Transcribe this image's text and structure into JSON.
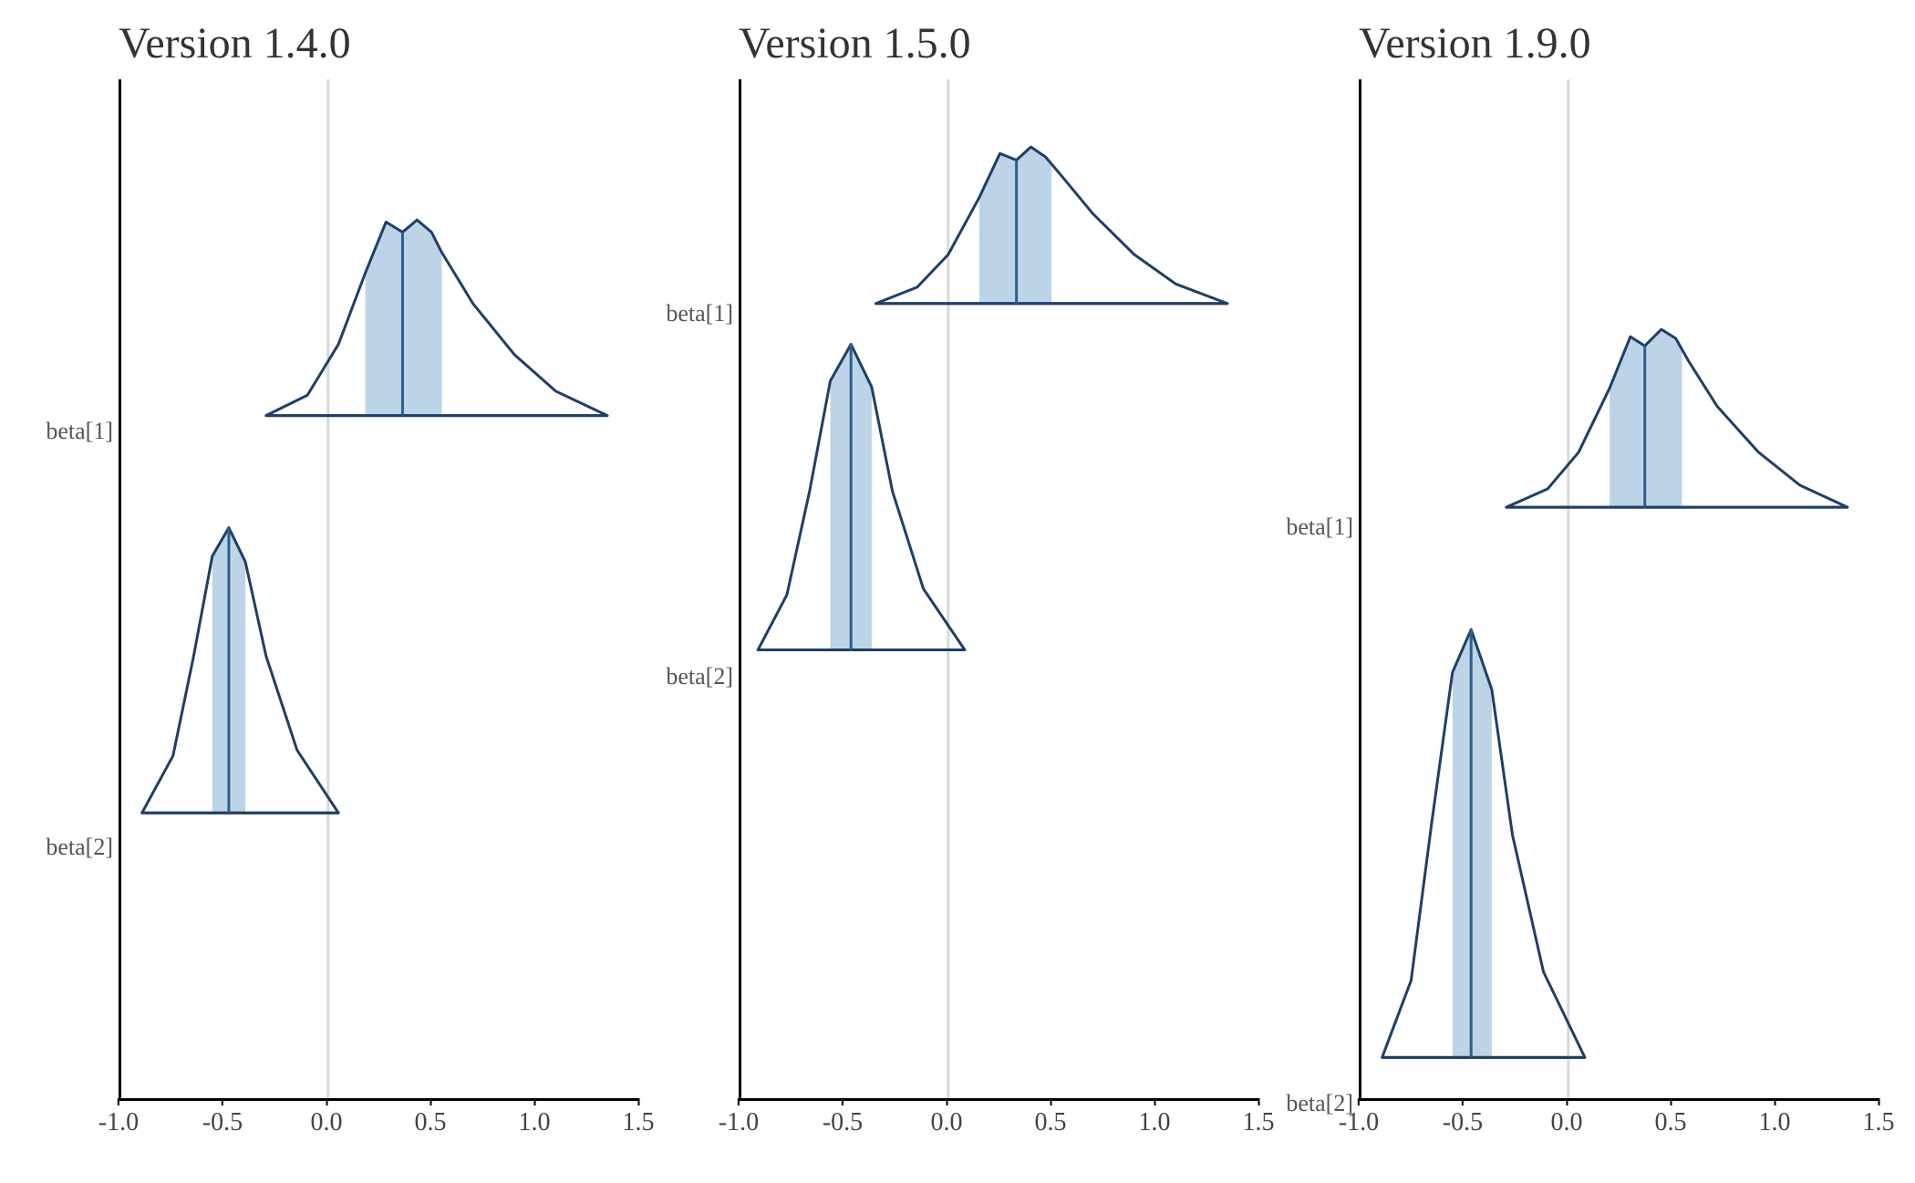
{
  "chart_data": [
    {
      "type": "area",
      "panel_title": "Version 1.4.0",
      "xlabel": "",
      "ylabel": "",
      "xlim": [
        -1.0,
        1.5
      ],
      "x_ticks": [
        -1.0,
        -0.5,
        0.0,
        0.5,
        1.0,
        1.5
      ],
      "y_categories": [
        "beta[1]",
        "beta[2]"
      ],
      "ridge": {
        "baseline_y_fraction": {
          "beta[1]": 0.33,
          "beta[2]": 0.72
        },
        "peak_height_fraction": {
          "beta[1]": 0.2,
          "beta[2]": 0.28
        }
      },
      "series": [
        {
          "name": "beta[1]",
          "point_estimate": 0.36,
          "interval": [
            0.18,
            0.55
          ],
          "density": {
            "x": [
              -0.3,
              -0.1,
              0.05,
              0.18,
              0.28,
              0.36,
              0.43,
              0.5,
              0.55,
              0.7,
              0.9,
              1.1,
              1.35
            ],
            "height": [
              0.0,
              0.1,
              0.35,
              0.7,
              0.95,
              0.9,
              0.96,
              0.9,
              0.8,
              0.55,
              0.3,
              0.12,
              0.0
            ]
          }
        },
        {
          "name": "beta[2]",
          "point_estimate": -0.48,
          "interval": [
            -0.56,
            -0.4
          ],
          "density": {
            "x": [
              -0.9,
              -0.75,
              -0.65,
              -0.56,
              -0.48,
              -0.4,
              -0.3,
              -0.15,
              0.05
            ],
            "height": [
              0.0,
              0.2,
              0.55,
              0.9,
              1.0,
              0.88,
              0.55,
              0.22,
              0.0
            ]
          }
        }
      ]
    },
    {
      "type": "area",
      "panel_title": "Version 1.5.0",
      "xlabel": "",
      "ylabel": "",
      "xlim": [
        -1.0,
        1.5
      ],
      "x_ticks": [
        -1.0,
        -0.5,
        0.0,
        0.5,
        1.0,
        1.5
      ],
      "y_categories": [
        "beta[1]",
        "beta[2]"
      ],
      "ridge": {
        "baseline_y_fraction": {
          "beta[1]": 0.22,
          "beta[2]": 0.56
        },
        "peak_height_fraction": {
          "beta[1]": 0.16,
          "beta[2]": 0.3
        }
      },
      "series": [
        {
          "name": "beta[1]",
          "point_estimate": 0.33,
          "interval": [
            0.15,
            0.5
          ],
          "density": {
            "x": [
              -0.35,
              -0.15,
              0.0,
              0.15,
              0.25,
              0.33,
              0.4,
              0.47,
              0.55,
              0.7,
              0.9,
              1.1,
              1.35
            ],
            "height": [
              0.0,
              0.1,
              0.3,
              0.65,
              0.92,
              0.88,
              0.96,
              0.9,
              0.78,
              0.55,
              0.3,
              0.12,
              0.0
            ]
          }
        },
        {
          "name": "beta[2]",
          "point_estimate": -0.47,
          "interval": [
            -0.57,
            -0.37
          ],
          "density": {
            "x": [
              -0.92,
              -0.78,
              -0.67,
              -0.57,
              -0.47,
              -0.37,
              -0.27,
              -0.12,
              0.08
            ],
            "height": [
              0.0,
              0.18,
              0.52,
              0.88,
              1.0,
              0.86,
              0.52,
              0.2,
              0.0
            ]
          }
        }
      ]
    },
    {
      "type": "area",
      "panel_title": "Version 1.9.0",
      "xlabel": "",
      "ylabel": "",
      "xlim": [
        -1.0,
        1.5
      ],
      "x_ticks": [
        -1.0,
        -0.5,
        0.0,
        0.5,
        1.0,
        1.5
      ],
      "y_categories": [
        "beta[1]",
        "beta[2]"
      ],
      "ridge": {
        "baseline_y_fraction": {
          "beta[1]": 0.42,
          "beta[2]": 0.96
        },
        "peak_height_fraction": {
          "beta[1]": 0.18,
          "beta[2]": 0.42
        }
      },
      "series": [
        {
          "name": "beta[1]",
          "point_estimate": 0.37,
          "interval": [
            0.2,
            0.55
          ],
          "density": {
            "x": [
              -0.3,
              -0.1,
              0.05,
              0.2,
              0.3,
              0.37,
              0.45,
              0.52,
              0.58,
              0.72,
              0.92,
              1.12,
              1.35
            ],
            "height": [
              0.0,
              0.1,
              0.3,
              0.65,
              0.93,
              0.88,
              0.97,
              0.92,
              0.8,
              0.55,
              0.3,
              0.12,
              0.0
            ]
          }
        },
        {
          "name": "beta[2]",
          "point_estimate": -0.47,
          "interval": [
            -0.56,
            -0.37
          ],
          "density": {
            "x": [
              -0.9,
              -0.76,
              -0.66,
              -0.56,
              -0.47,
              -0.37,
              -0.27,
              -0.12,
              0.08
            ],
            "height": [
              0.0,
              0.18,
              0.55,
              0.9,
              1.0,
              0.86,
              0.52,
              0.2,
              0.0
            ]
          }
        }
      ]
    }
  ],
  "colors": {
    "outline": "#1f3f66",
    "fill_interval": "#bcd4e6",
    "zero_line": "#d8d8d8",
    "accent_line": "#2a5f8f"
  }
}
